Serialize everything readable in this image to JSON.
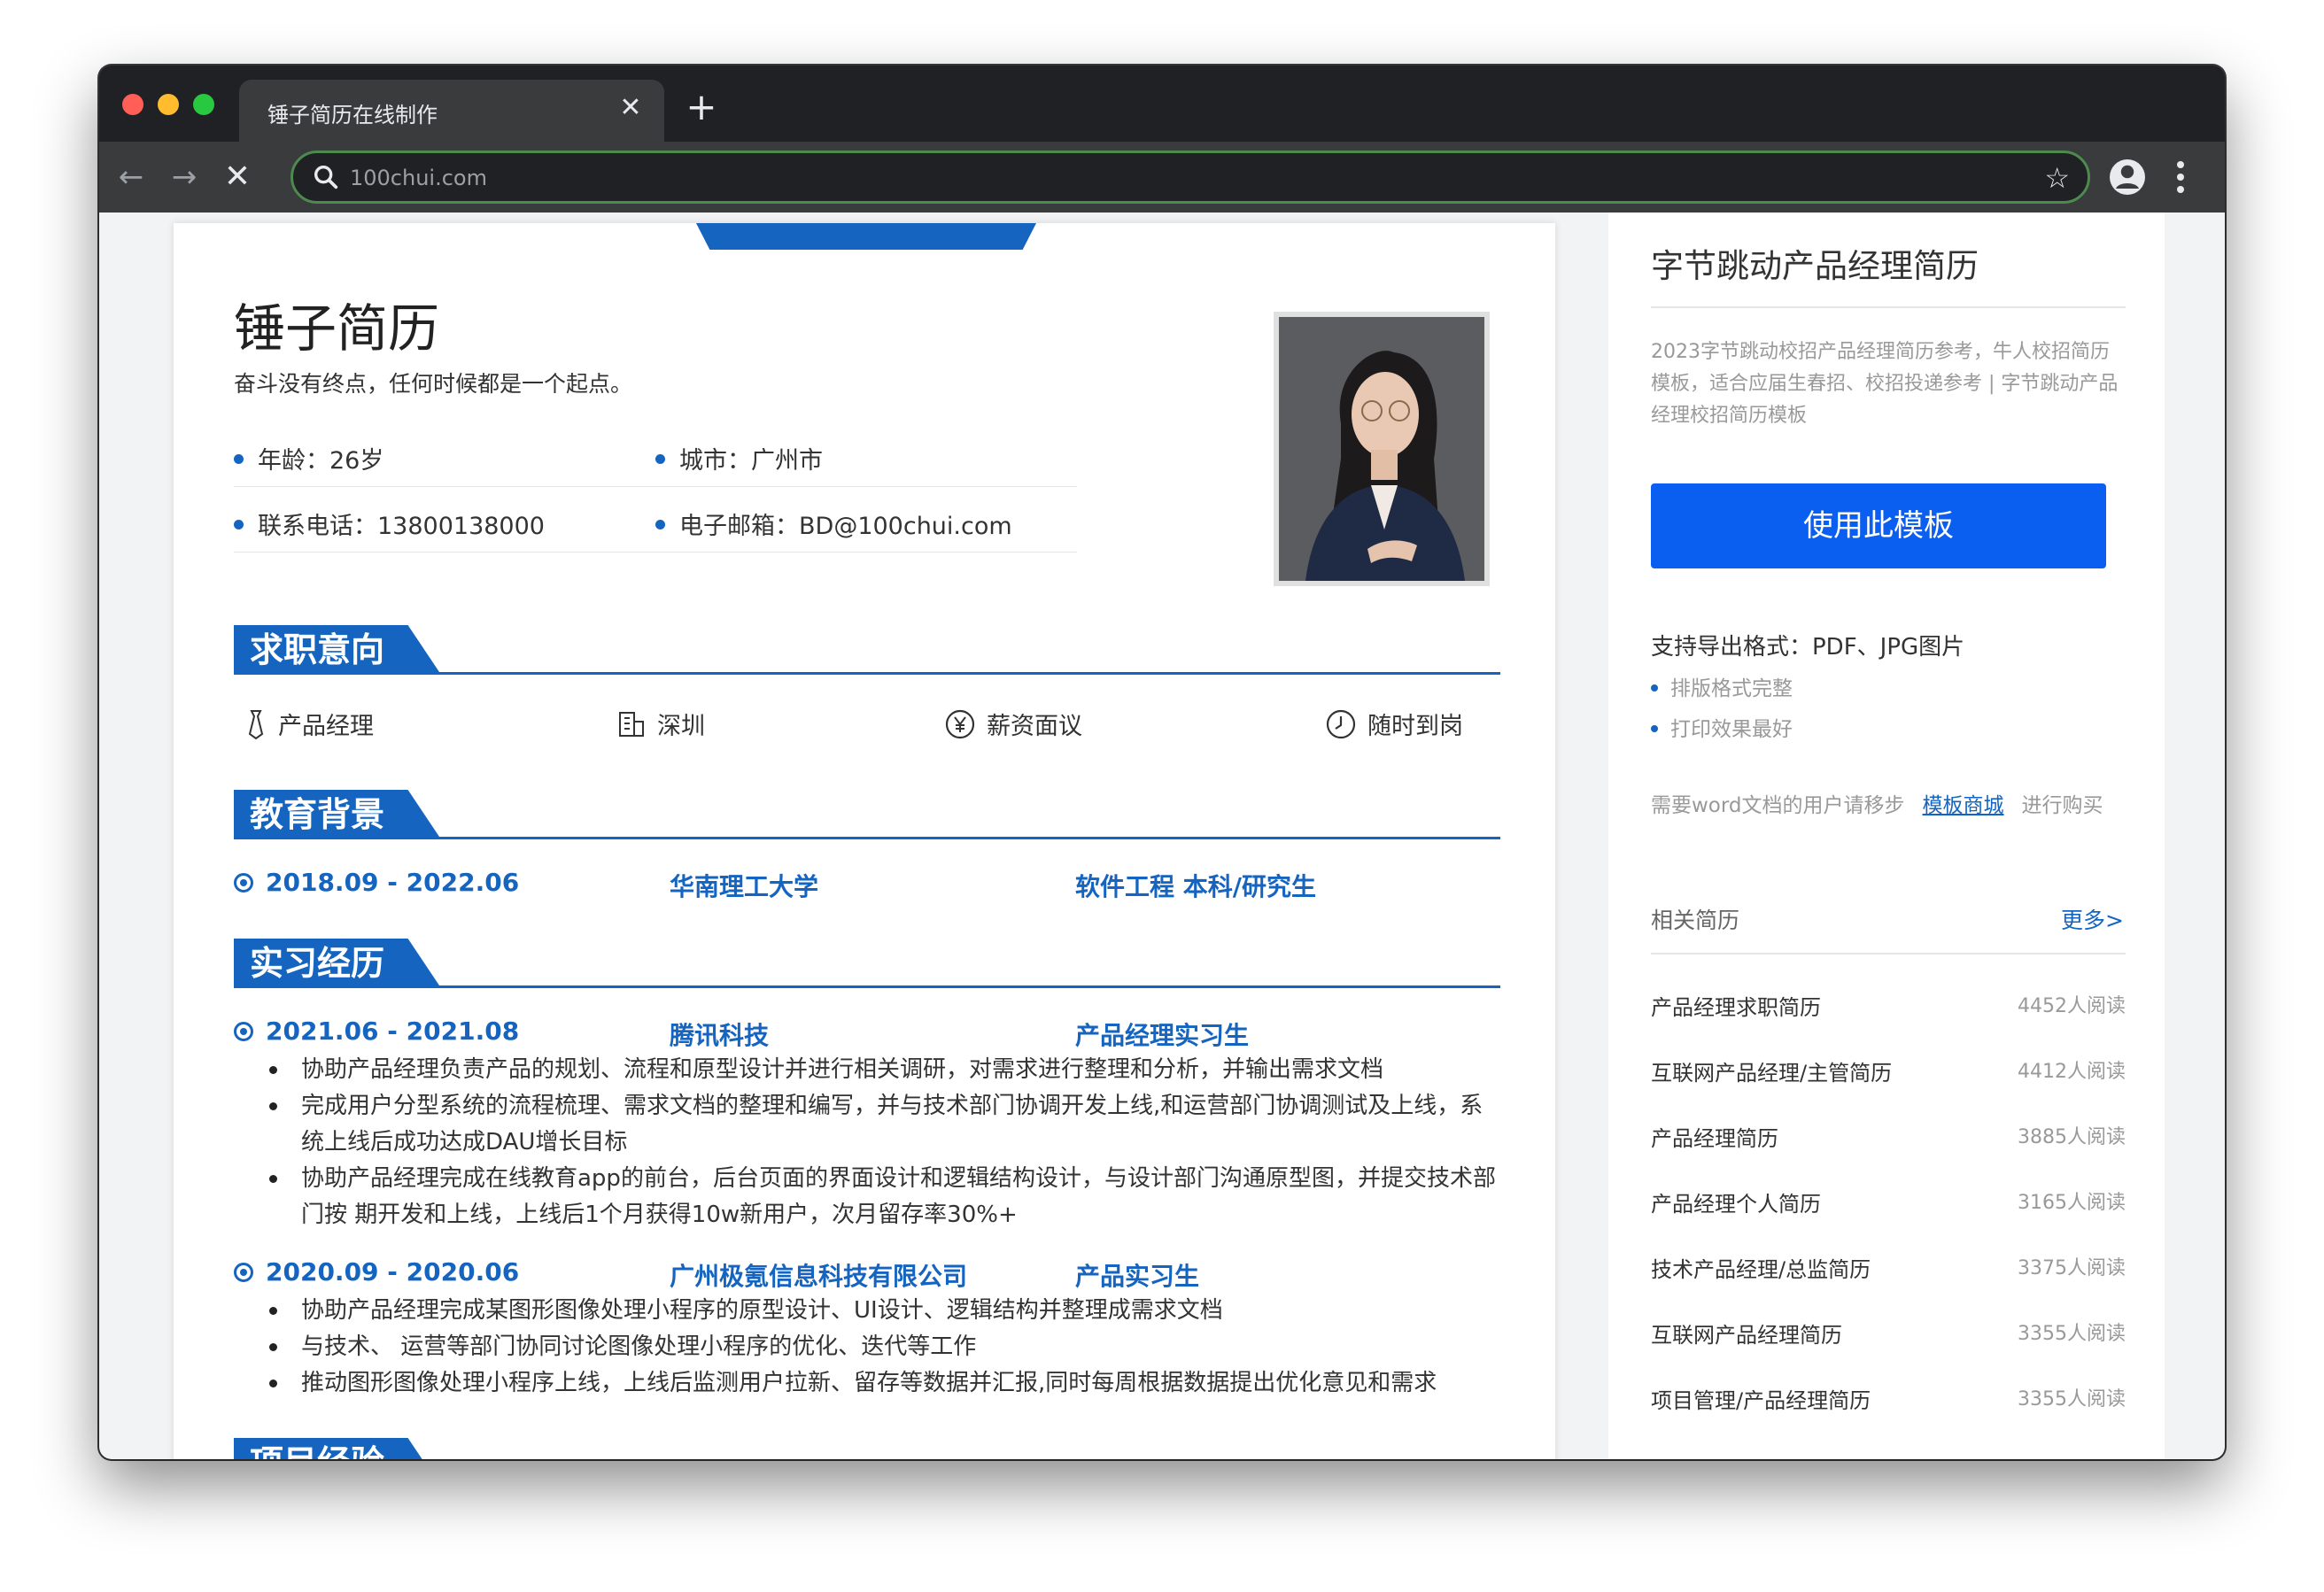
{
  "browser": {
    "tab_title": "锤子简历在线制作",
    "url": "100chui.com"
  },
  "resume": {
    "name": "锤子简历",
    "motto": "奋斗没有终点，任何时候都是一个起点。",
    "info": {
      "age": "年龄：26岁",
      "city": "城市：广州市",
      "phone": "联系电话：13800138000",
      "email": "电子邮箱：BD@100chui.com"
    },
    "sections": {
      "intent": "求职意向",
      "education": "教育背景",
      "internship": "实习经历",
      "project": "项目经验"
    },
    "intent": {
      "position": "产品经理",
      "city": "深圳",
      "salary": "薪资面议",
      "availability": "随时到岗"
    },
    "education": {
      "period": "2018.09 - 2022.06",
      "school": "华南理工大学",
      "major": "软件工程  本科/研究生"
    },
    "internships": [
      {
        "period": "2021.06 - 2021.08",
        "company": "腾讯科技",
        "role": "产品经理实习生",
        "bullets": [
          "协助产品经理负责产品的规划、流程和原型设计并进行相关调研，对需求进行整理和分析，并输出需求文档",
          "完成用户分型系统的流程梳理、需求文档的整理和编写，并与技术部门协调开发上线,和运营部门协调测试及上线，系统上线后成功达成DAU增长目标",
          "协助产品经理完成在线教育app的前台，后台页面的界面设计和逻辑结构设计，与设计部门沟通原型图，并提交技术部门按 期开发和上线，上线后1个月获得10w新用户，次月留存率30%+"
        ]
      },
      {
        "period": "2020.09 - 2020.06",
        "company": "广州极氪信息科技有限公司",
        "role": "产品实习生",
        "bullets": [
          "协助产品经理完成某图形图像处理小程序的原型设计、UI设计、逻辑结构并整理成需求文档",
          "与技术、 运营等部门协同讨论图像处理小程序的优化、迭代等工作",
          "推动图形图像处理小程序上线，上线后监测用户拉新、留存等数据并汇报,同时每周根据数据提出优化意见和需求"
        ]
      }
    ]
  },
  "sidebar": {
    "title": "字节跳动产品经理简历",
    "description": "2023字节跳动校招产品经理简历参考，牛人校招简历模板，适合应届生春招、校招投递参考 | 字节跳动产品经理校招简历模板",
    "use_button": "使用此模板",
    "export_formats": "支持导出格式：PDF、JPG图片",
    "features": [
      "排版格式完整",
      "打印效果最好"
    ],
    "note_prefix": "需要word文档的用户请移步",
    "note_link": "模板商城",
    "note_suffix": "进行购买",
    "related_title": "相关简历",
    "more": "更多>",
    "related": [
      {
        "title": "产品经理求职简历",
        "reads": "4452人阅读"
      },
      {
        "title": "互联网产品经理/主管简历",
        "reads": "4412人阅读"
      },
      {
        "title": "产品经理简历",
        "reads": "3885人阅读"
      },
      {
        "title": "产品经理个人简历",
        "reads": "3165人阅读"
      },
      {
        "title": "技术产品经理/总监简历",
        "reads": "3375人阅读"
      },
      {
        "title": "互联网产品经理简历",
        "reads": "3355人阅读"
      },
      {
        "title": "项目管理/产品经理简历",
        "reads": "3355人阅读"
      }
    ]
  }
}
